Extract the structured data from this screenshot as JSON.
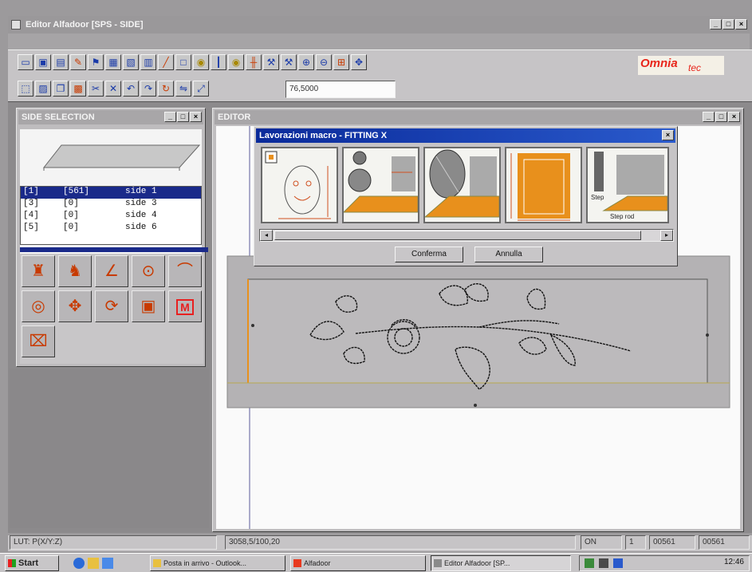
{
  "app": {
    "title": "Editor Alfadoor [SPS - SIDE]",
    "brand": {
      "main": "Omnia",
      "sub": "tec",
      "color": "#e8261c"
    }
  },
  "toolbar_row1": [
    "open-icon",
    "save-icon",
    "print-icon",
    "pencil-icon",
    "flag-icon",
    "grid-icon",
    "image-icon",
    "brush-icon",
    "line-icon",
    "square-icon",
    "lightbulb-icon",
    "vertical-icon",
    "lightbulb-icon",
    "split-icon",
    "tool-icon",
    "tool-icon",
    "zoom-in-icon",
    "zoom-out-icon",
    "zoom-fit-icon",
    "pan-icon"
  ],
  "toolbar_row2": [
    "select-icon",
    "layer-icon",
    "copy-icon",
    "paste-icon",
    "cut-icon",
    "delete-icon",
    "undo-icon",
    "redo-icon",
    "rotate-icon",
    "mirror-icon",
    "scale-icon"
  ],
  "toolbar_field": {
    "value": "76,5000"
  },
  "side_window": {
    "title": "SIDE SELECTION",
    "list": [
      {
        "col1": "[1]",
        "col2": "[561]",
        "col3": "side 1",
        "selected": true
      },
      {
        "col1": "[3]",
        "col2": "[0]",
        "col3": "side 3",
        "selected": false
      },
      {
        "col1": "[4]",
        "col2": "[0]",
        "col3": "side 4",
        "selected": false
      },
      {
        "col1": "[5]",
        "col2": "[0]",
        "col3": "side 6",
        "selected": false
      }
    ],
    "tools": [
      "bottle-tool-icon",
      "profile-tool-icon",
      "angle-tool-icon",
      "drill-tool-icon",
      "curve-tool-icon",
      "circle-tool-icon",
      "move-tool-icon",
      "rotate-tool-icon",
      "open-tool-icon",
      "macro-m-icon",
      "cut-tool-icon"
    ],
    "macro_label": "M"
  },
  "editor_window": {
    "title": "EDITOR"
  },
  "macro_dialog": {
    "title": "Lavorazioni macro - FITTING X",
    "thumbnails": [
      "face-template",
      "sink-hole-fitting",
      "oval-profile-fitting",
      "orange-panel-fitting",
      "rack-profile-fitting"
    ],
    "thumb_labels": {
      "thumb5_text1": "Step",
      "thumb5_text2": "Step rod"
    },
    "confirm_label": "Conferma",
    "cancel_label": "Annulla"
  },
  "status_bar": {
    "left": "LUT: P(X/Y:Z)",
    "coords": "3058,5/100,20",
    "mode": "ON",
    "flag": "1",
    "count1": "00561",
    "count2": "00561"
  },
  "taskbar": {
    "start_label": "Start",
    "tasks": [
      "Posta in arrivo - Outlook...",
      "Alfadoor",
      "Editor Alfadoor [SP..."
    ],
    "clock": "12:46"
  },
  "colors": {
    "orange": "#e8901c",
    "selection": "#1a2a8a",
    "active_title": "#0a2a9a"
  }
}
